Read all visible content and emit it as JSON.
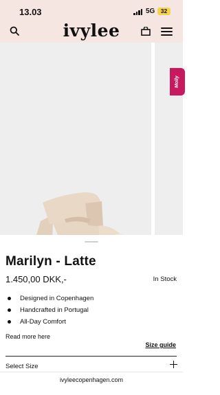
{
  "status_bar": {
    "time": "13.03",
    "network": "5G",
    "battery": "32"
  },
  "header": {
    "brand": "ivylee"
  },
  "icons": {
    "search": "search-icon",
    "bag": "bag-icon",
    "menu": "menu-icon",
    "plus": "plus-icon"
  },
  "gallery": {
    "chat_badge": "Molly"
  },
  "product": {
    "name": "Marilyn - Latte",
    "price": "1.450,00 DKK,-",
    "stock": "In Stock",
    "features": [
      "Designed in Copenhagen",
      "Handcrafted in Portugal",
      "All-Day Comfort"
    ],
    "read_more": "Read more here",
    "size_guide": "Size guide",
    "select_size": "Select Size"
  },
  "browser": {
    "url": "ivyleecopenhagen.com"
  },
  "colors": {
    "header_bg": "#f6e6e1",
    "gallery_bg": "#eeeeef",
    "chat_badge": "#c8195f",
    "shoe": "#ead8c6"
  }
}
